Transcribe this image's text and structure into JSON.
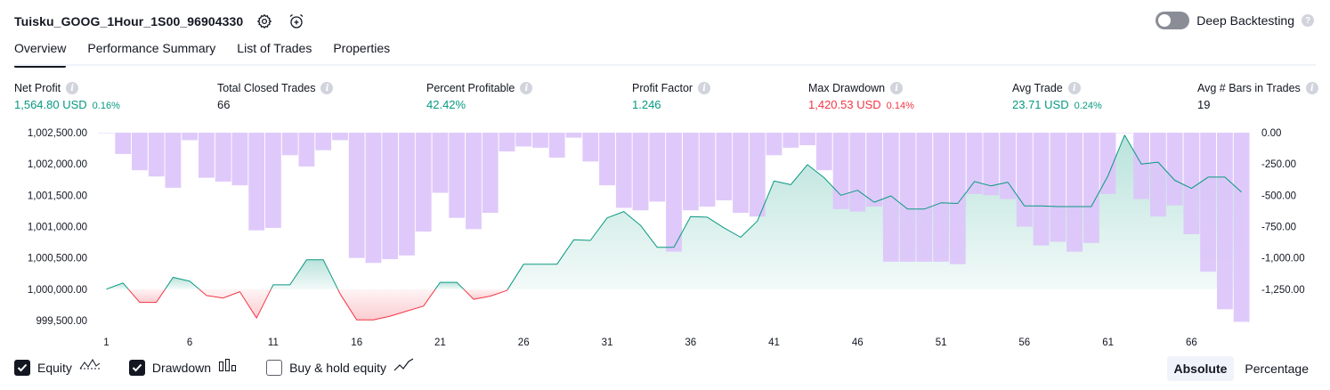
{
  "header": {
    "strategy_name": "Tuisku_GOOG_1Hour_1S00_96904330",
    "settings_icon": "gear-icon",
    "alert_icon": "alarm-clock-plus-icon",
    "deep_backtesting_label": "Deep Backtesting",
    "deep_backtesting_enabled": false,
    "help_icon": "question-icon"
  },
  "tabs": [
    {
      "label": "Overview",
      "active": true
    },
    {
      "label": "Performance Summary",
      "active": false
    },
    {
      "label": "List of Trades",
      "active": false
    },
    {
      "label": "Properties",
      "active": false
    }
  ],
  "stats": [
    {
      "title": "Net Profit",
      "value": "1,564.80 USD",
      "pct": "0.16%",
      "tone": "green"
    },
    {
      "title": "Total Closed Trades",
      "value": "66",
      "pct": "",
      "tone": "dark"
    },
    {
      "title": "Percent Profitable",
      "value": "42.42%",
      "pct": "",
      "tone": "green"
    },
    {
      "title": "Profit Factor",
      "value": "1.246",
      "pct": "",
      "tone": "green"
    },
    {
      "title": "Max Drawdown",
      "value": "1,420.53 USD",
      "pct": "0.14%",
      "tone": "red"
    },
    {
      "title": "Avg Trade",
      "value": "23.71 USD",
      "pct": "0.24%",
      "tone": "green"
    },
    {
      "title": "Avg # Bars in Trades",
      "value": "19",
      "pct": "",
      "tone": "dark"
    }
  ],
  "colors": {
    "profit": "#089981",
    "loss": "#f23645",
    "drawdown_bar": "#dcc4fa",
    "equity_fill_up": "#d8f0ea",
    "equity_fill_down": "#fbd3d6"
  },
  "chart_data": {
    "type": "line",
    "series": [
      {
        "name": "Equity",
        "axis": "left",
        "values": [
          1000000,
          1000100,
          999790,
          999790,
          1000190,
          1000130,
          999900,
          999860,
          999960,
          999540,
          1000070,
          1000070,
          1000470,
          1000470,
          999930,
          999510,
          999510,
          999570,
          999650,
          999730,
          1000110,
          1000110,
          999840,
          999890,
          999980,
          1000400,
          1000400,
          1000400,
          1000790,
          1000780,
          1001140,
          1001240,
          1001020,
          1000670,
          1000670,
          1001160,
          1001150,
          1000980,
          1000830,
          1001090,
          1001730,
          1001670,
          1001990,
          1001780,
          1001500,
          1001580,
          1001390,
          1001490,
          1001280,
          1001280,
          1001380,
          1001370,
          1001720,
          1001650,
          1001710,
          1001330,
          1001330,
          1001320,
          1001320,
          1001320,
          1001810,
          1002460,
          1002000,
          1002030,
          1001740,
          1001610,
          1001790,
          1001790,
          1001550
        ],
        "x_start": 1
      },
      {
        "name": "Drawdown",
        "axis": "right",
        "type": "bar",
        "values": [
          0,
          -170,
          -300,
          -350,
          -440,
          -60,
          -360,
          -390,
          -420,
          -780,
          -760,
          -180,
          -270,
          -140,
          -60,
          -1000,
          -1040,
          -1010,
          -980,
          -790,
          -480,
          -680,
          -770,
          -640,
          -150,
          -110,
          -120,
          -200,
          -40,
          -230,
          -420,
          -600,
          -620,
          -550,
          -950,
          -620,
          -590,
          -540,
          -640,
          -670,
          -180,
          -120,
          -100,
          -300,
          -610,
          -630,
          -590,
          -1030,
          -1030,
          -1030,
          -1030,
          -1050,
          -490,
          -500,
          -530,
          -750,
          -900,
          -870,
          -950,
          -880,
          -490,
          0,
          -530,
          -670,
          -580,
          -810,
          -1110,
          -1410,
          -1510
        ],
        "x_start": 1
      }
    ],
    "x_ticks": [
      "1",
      "6",
      "11",
      "16",
      "21",
      "26",
      "31",
      "36",
      "41",
      "46",
      "51",
      "56",
      "61",
      "66"
    ],
    "left_axis_ticks": [
      "1,002,500.00",
      "1,002,000.00",
      "1,001,500.00",
      "1,001,000.00",
      "1,000,500.00",
      "1,000,000.00",
      "999,500.00"
    ],
    "left_axis_range": [
      999500,
      1002500
    ],
    "right_axis_ticks": [
      "0.00",
      "-250.00",
      "-500.00",
      "-750.00",
      "-1,000.00",
      "-1,250.00"
    ],
    "right_axis_range": [
      -1500,
      0
    ],
    "baseline": 1000000
  },
  "legend": {
    "items": [
      {
        "label": "Equity",
        "checked": true,
        "icon": "equity-line-icon"
      },
      {
        "label": "Drawdown",
        "checked": true,
        "icon": "drawdown-bars-icon"
      },
      {
        "label": "Buy & hold equity",
        "checked": false,
        "icon": "buy-hold-line-icon"
      }
    ]
  },
  "view_mode": {
    "options": [
      "Absolute",
      "Percentage"
    ],
    "selected": "Absolute"
  }
}
